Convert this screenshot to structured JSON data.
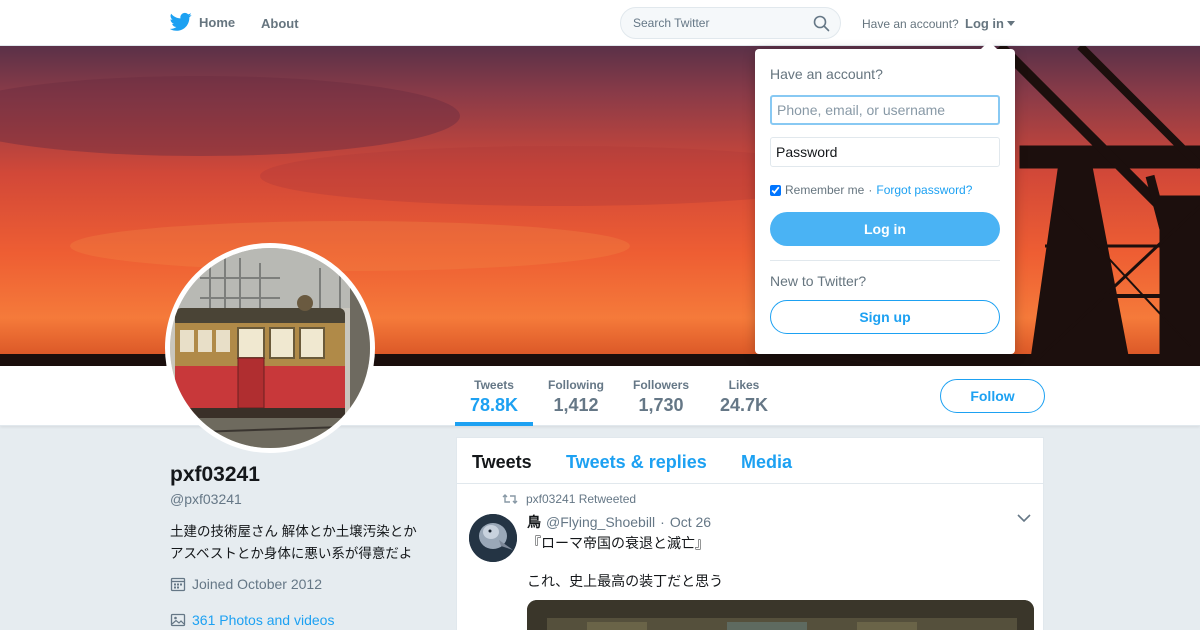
{
  "nav": {
    "home_label": "Home",
    "about_label": "About",
    "search_placeholder": "Search Twitter",
    "have_account": "Have an account?",
    "login_label": "Log in"
  },
  "login_dropdown": {
    "title": "Have an account?",
    "username_placeholder": "Phone, email, or username",
    "password_placeholder": "Password",
    "remember_me": "Remember me",
    "separator": "·",
    "forgot_password": "Forgot password?",
    "remember_checked": true,
    "login_button": "Log in",
    "new_to_twitter": "New to Twitter?",
    "signup_button": "Sign up"
  },
  "profile": {
    "name": "pxf03241",
    "handle": "@pxf03241",
    "bio_line1": "土建の技術屋さん 解体とか土壌汚染とか",
    "bio_line2": "アスベストとか身体に悪い系が得意だよ",
    "joined": "Joined October 2012",
    "photos": "361 Photos and videos"
  },
  "stats": [
    {
      "label": "Tweets",
      "value": "78.8K",
      "active": true
    },
    {
      "label": "Following",
      "value": "1,412",
      "active": false
    },
    {
      "label": "Followers",
      "value": "1,730",
      "active": false
    },
    {
      "label": "Likes",
      "value": "24.7K",
      "active": false
    }
  ],
  "follow_button": "Follow",
  "timeline": {
    "tabs": [
      "Tweets",
      "Tweets & replies",
      "Media"
    ],
    "active_tab": "Tweets",
    "tweet": {
      "retweet_note": "pxf03241 Retweeted",
      "display_name": "鳥",
      "handle": "@Flying_Shoebill",
      "separator": "·",
      "date": "Oct 26",
      "text_line1": "『ローマ帝国の衰退と滅亡』",
      "text_line2": "これ、史上最高の装丁だと思う"
    }
  },
  "colors": {
    "brand_blue": "#1da1f2",
    "nav_gray": "#66757f",
    "background": "#e6ecf0"
  },
  "icons": [
    "twitter-bird-icon",
    "home-icon",
    "search-icon",
    "caret-down-icon",
    "calendar-icon",
    "photo-icon",
    "retweet-icon",
    "chevron-down-icon"
  ]
}
